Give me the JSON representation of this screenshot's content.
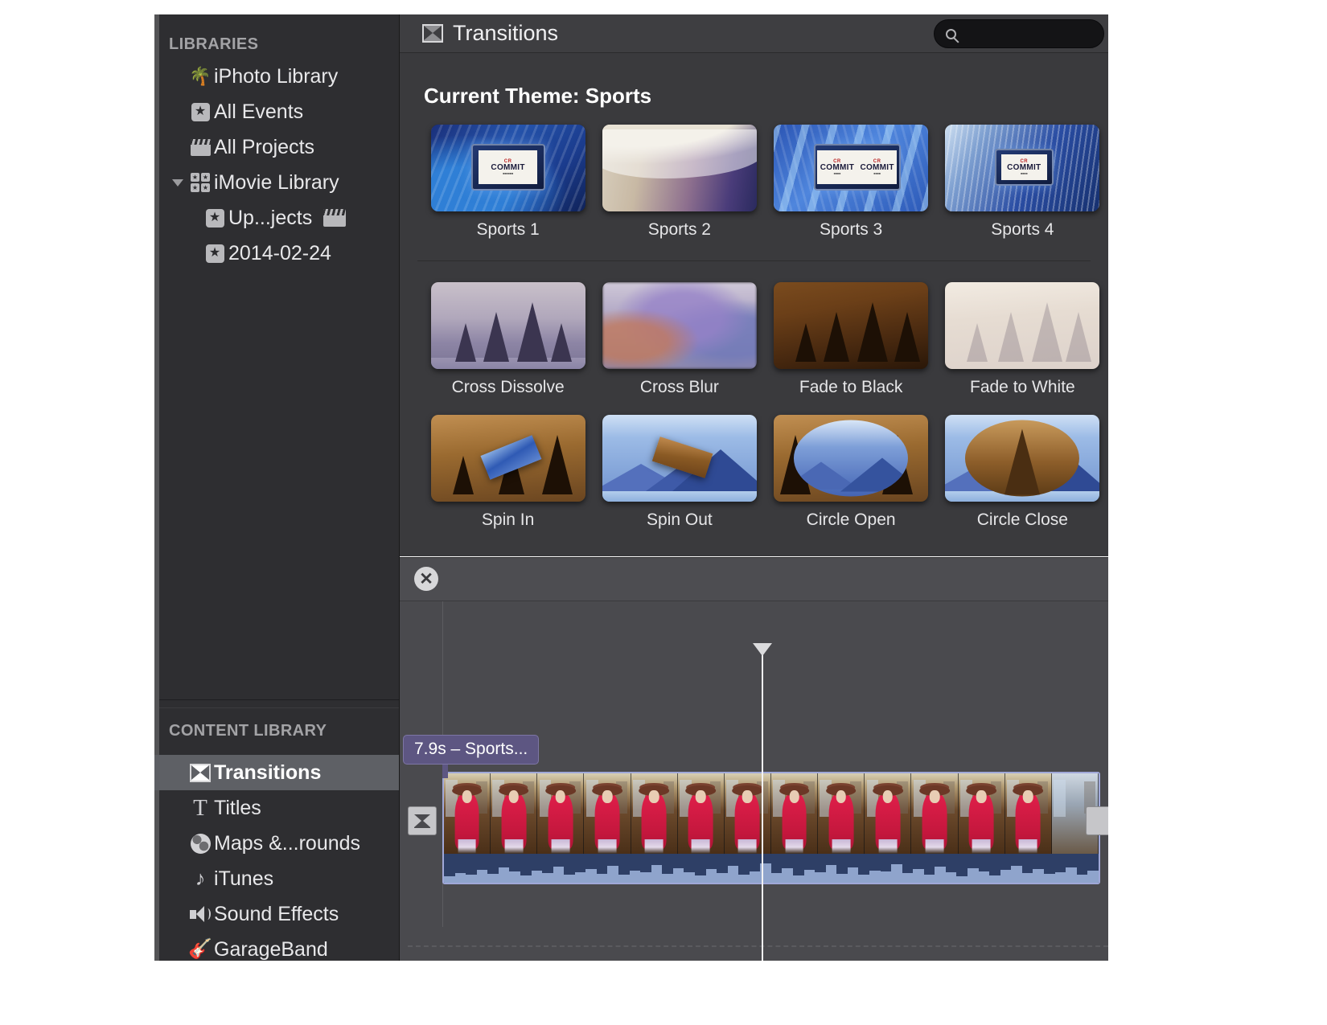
{
  "sidebar": {
    "libraries_header": "LIBRARIES",
    "libraries": [
      {
        "label": "iPhoto Library",
        "icon": "palm-tree-icon",
        "indent": false,
        "twisty": "",
        "trailing": ""
      },
      {
        "label": "All Events",
        "icon": "star-icon",
        "indent": false,
        "twisty": "",
        "trailing": ""
      },
      {
        "label": "All Projects",
        "icon": "clapperboard-icon",
        "indent": false,
        "twisty": "",
        "trailing": ""
      },
      {
        "label": "iMovie Library",
        "icon": "grid-star-icon",
        "indent": false,
        "twisty": "disclosure-triangle-down",
        "trailing": ""
      },
      {
        "label": "Up...jects",
        "icon": "star-icon",
        "indent": true,
        "twisty": "",
        "trailing": "clapperboard-icon"
      },
      {
        "label": "2014-02-24",
        "icon": "star-icon",
        "indent": true,
        "twisty": "",
        "trailing": ""
      }
    ],
    "content_header": "CONTENT LIBRARY",
    "content_items": [
      {
        "label": "Transitions",
        "icon": "transition-icon",
        "selected": true
      },
      {
        "label": "Titles",
        "icon": "text-t-icon",
        "selected": false
      },
      {
        "label": "Maps &...rounds",
        "icon": "globe-icon",
        "selected": false
      },
      {
        "label": "iTunes",
        "icon": "music-note-icon",
        "selected": false
      },
      {
        "label": "Sound Effects",
        "icon": "speaker-icon",
        "selected": false
      },
      {
        "label": "GarageBand",
        "icon": "guitar-icon",
        "selected": false
      }
    ]
  },
  "browser": {
    "title": "Transitions",
    "title_icon": "transition-icon",
    "search_placeholder": "",
    "search_value": "",
    "search_icon": "search-icon",
    "theme_heading": "Current Theme: Sports",
    "theme_row": [
      {
        "label": "Sports 1",
        "art": "sports-1"
      },
      {
        "label": "Sports 2",
        "art": "sports-2"
      },
      {
        "label": "Sports 3",
        "art": "sports-3"
      },
      {
        "label": "Sports 4",
        "art": "sports-4"
      }
    ],
    "standard_row_1": [
      {
        "label": "Cross Dissolve",
        "art": "forest"
      },
      {
        "label": "Cross Blur",
        "art": "blur"
      },
      {
        "label": "Fade to Black",
        "art": "black"
      },
      {
        "label": "Fade to White",
        "art": "white"
      }
    ],
    "standard_row_2": [
      {
        "label": "Spin In",
        "art": "spin-in"
      },
      {
        "label": "Spin Out",
        "art": "spin-out"
      },
      {
        "label": "Circle Open",
        "art": "circle-open"
      },
      {
        "label": "Circle Close",
        "art": "circle-close"
      }
    ]
  },
  "timeline": {
    "close_label": "✕",
    "close_icon": "close-circle-icon",
    "clip_badge": "7.9s – Sports...",
    "transition_icon_left": "transition-icon",
    "transition_icon_right": "transition-icon",
    "music_note": "♪",
    "playhead_icon": "playhead-marker"
  },
  "colors": {
    "sidebar_bg": "#2e2e31",
    "selection": "#5e6065",
    "browser_bg": "#3a3a3d",
    "timeline_bg": "#4a4a4e",
    "badge_purple": "#5d5682",
    "clip_border": "#a0a8d8",
    "text_primary": "#e8e8ea",
    "text_muted": "#a3a3a6"
  }
}
